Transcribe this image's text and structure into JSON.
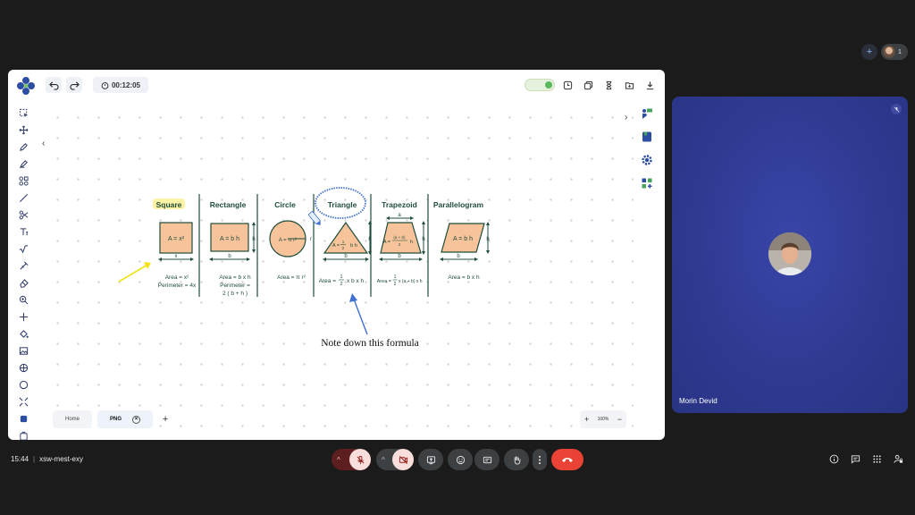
{
  "top_right": {
    "participant_count": "1"
  },
  "board": {
    "timer": "00:12:05",
    "columns": [
      {
        "title": "Square",
        "formula_lines": [
          "Area = x²",
          "Perimeter = 4x"
        ],
        "shape_label": "A = x²",
        "dim_bottom": "x"
      },
      {
        "title": "Rectangle",
        "formula_lines": [
          "Area = b x h",
          "Perimeter =",
          "2 ( b + h )"
        ],
        "shape_label": "A = b h",
        "dim_bottom": "b",
        "dim_side": "h"
      },
      {
        "title": "Circle",
        "formula_lines": [
          "Area = π r²"
        ],
        "shape_label": "A = π r²",
        "dim_side": "r"
      },
      {
        "title": "Triangle",
        "formula_prefix": "Area =",
        "formula_num": "1",
        "formula_den": "2",
        "formula_suffix": "x b x h",
        "shape_label": "A =",
        "shape_suffix": "b h",
        "dim_bottom": "b",
        "dim_side": "h"
      },
      {
        "title": "Trapezoid",
        "formula_prefix": "Area =",
        "formula_num": "1",
        "formula_den": "2",
        "formula_suffix": "x (a + b) x h",
        "shape_prefix": "A =",
        "shape_num": "(a + b)",
        "shape_den": "2",
        "shape_suffix": "h",
        "dim_top": "a",
        "dim_bottom": "b",
        "dim_side": "h"
      },
      {
        "title": "Parallelogram",
        "formula_lines": [
          "Area = b x h"
        ],
        "shape_label": "A = b h",
        "dim_bottom": "b",
        "dim_side": "h"
      }
    ],
    "annotation": "Note down this formula",
    "tabs": [
      {
        "label": "Home"
      },
      {
        "label": "PNG"
      }
    ],
    "zoom": "100%"
  },
  "video": {
    "name": "Morin Devid"
  },
  "bottom_bar": {
    "time": "15:44",
    "meeting_code": "xsw-mest-exy"
  },
  "colors": {
    "shape_fill": "#f7c39a",
    "title_highlight": "#fbf3a6",
    "heading_color": "#1f4d3a",
    "end_call": "#ea4335",
    "muted_bg": "#f9dedc"
  }
}
